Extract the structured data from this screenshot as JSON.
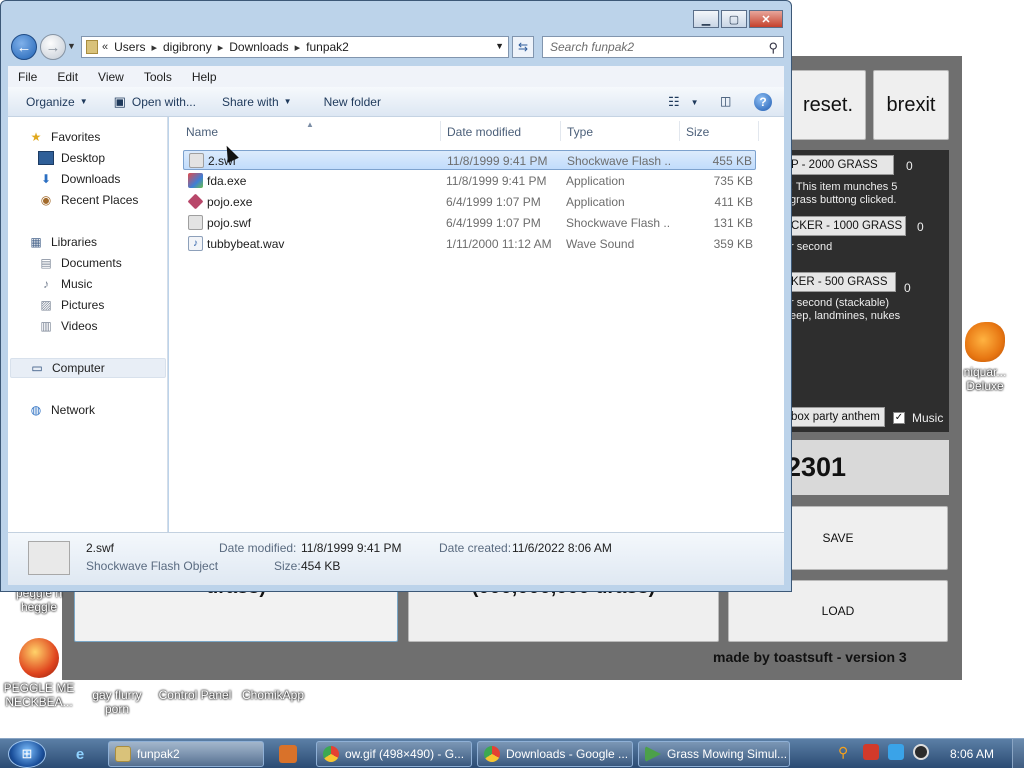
{
  "game": {
    "reset_label": "reset.",
    "brexit_label": "brexit",
    "shop": {
      "item1_label": "P - 2000 GRASS",
      "item1_count": "0",
      "item1_desc1": "! This item munches 5",
      "item1_desc2": "grass buttong clicked.",
      "item2_label": "CKER - 1000 GRASS",
      "item2_count": "0",
      "item2_desc1": "r second",
      "item3_label": "KER - 500 GRASS",
      "item3_count": "0",
      "item3_desc1": "r second (stackable)",
      "item3_desc2": "eep, landmines, nukes",
      "anthem_label": "box party anthem",
      "music_label": "Music",
      "music_checked": true
    },
    "score": "2301",
    "save_label": "SAVE",
    "load_label": "LOAD",
    "upgrade_left_text": "urass)",
    "upgrade_mid_text": "(000,000,000 urass)",
    "credit": "made by toastsuft - version 3"
  },
  "desktop_icons": [
    {
      "label": "peggle n\nheggle"
    },
    {
      "label": "PEGGLE ME\nNECKBEA..."
    },
    {
      "label": "gay flurry\nporn"
    },
    {
      "label": "Control Panel"
    },
    {
      "label": "ChomikApp"
    },
    {
      "label": "niquar...\nDeluxe"
    }
  ],
  "explorer": {
    "address": {
      "overflow": "«",
      "segments": [
        "Users",
        "digibrony",
        "Downloads",
        "funpak2"
      ]
    },
    "search_placeholder": "Search funpak2",
    "menu": [
      "File",
      "Edit",
      "View",
      "Tools",
      "Help"
    ],
    "toolbar": {
      "organize": "Organize",
      "open_with": "Open with...",
      "share_with": "Share with",
      "new_folder": "New folder"
    },
    "nav": {
      "favorites": "Favorites",
      "desktop": "Desktop",
      "downloads": "Downloads",
      "recent": "Recent Places",
      "libraries": "Libraries",
      "documents": "Documents",
      "music": "Music",
      "pictures": "Pictures",
      "videos": "Videos",
      "computer": "Computer",
      "network": "Network"
    },
    "columns": [
      "Name",
      "Date modified",
      "Type",
      "Size"
    ],
    "files": [
      {
        "name": "2.swf",
        "date": "11/8/1999 9:41 PM",
        "type": "Shockwave Flash ...",
        "size": "455 KB"
      },
      {
        "name": "fda.exe",
        "date": "11/8/1999 9:41 PM",
        "type": "Application",
        "size": "735 KB"
      },
      {
        "name": "pojo.exe",
        "date": "6/4/1999 1:07 PM",
        "type": "Application",
        "size": "411 KB"
      },
      {
        "name": "pojo.swf",
        "date": "6/4/1999 1:07 PM",
        "type": "Shockwave Flash ...",
        "size": "131 KB"
      },
      {
        "name": "tubbybeat.wav",
        "date": "1/11/2000 11:12 AM",
        "type": "Wave Sound",
        "size": "359 KB"
      }
    ],
    "details": {
      "name": "2.swf",
      "type": "Shockwave Flash Object",
      "modified_label": "Date modified:",
      "modified_value": "11/8/1999 9:41 PM",
      "created_label": "Date created:",
      "created_value": "11/6/2022 8:06 AM",
      "size_label": "Size:",
      "size_value": "454 KB"
    }
  },
  "taskbar": {
    "tasks": [
      {
        "label": "funpak2"
      },
      {
        "label": "ow.gif (498×490) - G..."
      },
      {
        "label": "Downloads - Google ..."
      },
      {
        "label": "Grass Mowing Simul..."
      }
    ],
    "clock": "8:06 AM"
  },
  "colors": {
    "window_frame": "#bcd3ea",
    "selection": "#c1dcfc",
    "taskbar": "#2b4b73",
    "game_panel": "#6f6f6f"
  }
}
